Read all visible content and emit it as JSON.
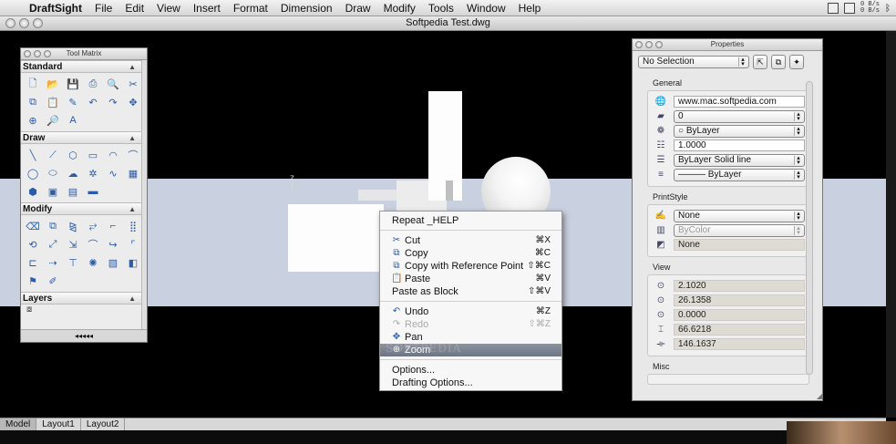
{
  "menubar": {
    "app_name": "DraftSight",
    "items": [
      "File",
      "Edit",
      "View",
      "Insert",
      "Format",
      "Dimension",
      "Draw",
      "Modify",
      "Tools",
      "Window",
      "Help"
    ],
    "net_up": "0 B/s",
    "net_down": "0 B/s"
  },
  "document": {
    "title": "Softpedia Test.dwg"
  },
  "tool_matrix": {
    "title": "Tool Matrix",
    "sections": {
      "standard": "Standard",
      "draw": "Draw",
      "modify": "Modify",
      "layers": "Layers"
    },
    "footer": "◂◂◂◂◂"
  },
  "tabs": [
    "Model",
    "Layout1",
    "Layout2"
  ],
  "context_menu": {
    "repeat": "Repeat _HELP",
    "cut": {
      "label": "Cut",
      "shortcut": "⌘X"
    },
    "copy": {
      "label": "Copy",
      "shortcut": "⌘C"
    },
    "copy_ref": {
      "label": "Copy with Reference Point",
      "shortcut": "⇧⌘C"
    },
    "paste": {
      "label": "Paste",
      "shortcut": "⌘V"
    },
    "paste_block": {
      "label": "Paste as Block",
      "shortcut": "⇧⌘V"
    },
    "undo": {
      "label": "Undo",
      "shortcut": "⌘Z"
    },
    "redo": {
      "label": "Redo",
      "shortcut": "⇧⌘Z"
    },
    "pan": {
      "label": "Pan"
    },
    "zoom": {
      "label": "Zoom"
    },
    "options": "Options...",
    "drafting_options": "Drafting Options...",
    "watermark": "SOFTPEDIA"
  },
  "properties": {
    "title": "Properties",
    "selection": "No Selection",
    "general": {
      "label": "General",
      "hyperlink": "www.mac.softpedia.com",
      "layer": "0",
      "color": "○ ByLayer",
      "linescale": "1.0000",
      "linetype": "ByLayer     Solid line",
      "lineweight": "——— ByLayer"
    },
    "printstyle": {
      "label": "PrintStyle",
      "style": "None",
      "color": "ByColor",
      "table": "None"
    },
    "view": {
      "label": "View",
      "center_x": "2.1020",
      "center_y": "26.1358",
      "center_z": "0.0000",
      "height": "66.6218",
      "width": "146.1637"
    },
    "misc": {
      "label": "Misc"
    }
  },
  "colors": {
    "menu_highlight": "#7a8190",
    "ground": "#c9d0e0",
    "icon_blue": "#2a5ca8"
  }
}
